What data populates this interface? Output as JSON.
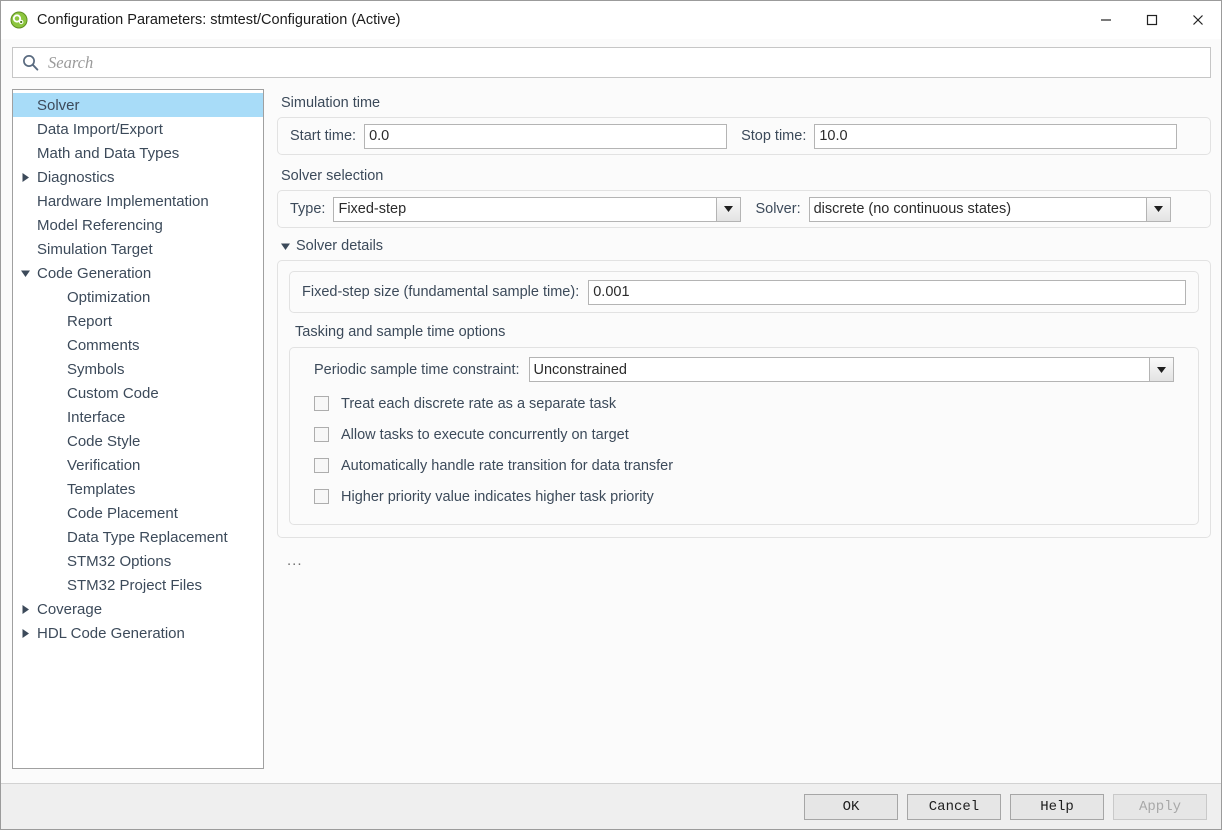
{
  "window": {
    "title": "Configuration Parameters: stmtest/Configuration (Active)",
    "app_icon": "simulink-icon",
    "controls": {
      "minimize": "minimize-icon",
      "maximize": "maximize-icon",
      "close": "close-icon"
    }
  },
  "search": {
    "icon": "search-icon",
    "placeholder": "Search",
    "value": ""
  },
  "sidebar": {
    "items": [
      {
        "label": "Solver",
        "level": 0,
        "arrow": "none",
        "selected": true
      },
      {
        "label": "Data Import/Export",
        "level": 0,
        "arrow": "none",
        "selected": false
      },
      {
        "label": "Math and Data Types",
        "level": 0,
        "arrow": "none",
        "selected": false
      },
      {
        "label": "Diagnostics",
        "level": 0,
        "arrow": "collapsed",
        "selected": false
      },
      {
        "label": "Hardware Implementation",
        "level": 0,
        "arrow": "none",
        "selected": false
      },
      {
        "label": "Model Referencing",
        "level": 0,
        "arrow": "none",
        "selected": false
      },
      {
        "label": "Simulation Target",
        "level": 0,
        "arrow": "none",
        "selected": false
      },
      {
        "label": "Code Generation",
        "level": 0,
        "arrow": "expanded",
        "selected": false
      },
      {
        "label": "Optimization",
        "level": 1,
        "arrow": "none",
        "selected": false
      },
      {
        "label": "Report",
        "level": 1,
        "arrow": "none",
        "selected": false
      },
      {
        "label": "Comments",
        "level": 1,
        "arrow": "none",
        "selected": false
      },
      {
        "label": "Symbols",
        "level": 1,
        "arrow": "none",
        "selected": false
      },
      {
        "label": "Custom Code",
        "level": 1,
        "arrow": "none",
        "selected": false
      },
      {
        "label": "Interface",
        "level": 1,
        "arrow": "none",
        "selected": false
      },
      {
        "label": "Code Style",
        "level": 1,
        "arrow": "none",
        "selected": false
      },
      {
        "label": "Verification",
        "level": 1,
        "arrow": "none",
        "selected": false
      },
      {
        "label": "Templates",
        "level": 1,
        "arrow": "none",
        "selected": false
      },
      {
        "label": "Code Placement",
        "level": 1,
        "arrow": "none",
        "selected": false
      },
      {
        "label": "Data Type Replacement",
        "level": 1,
        "arrow": "none",
        "selected": false
      },
      {
        "label": "STM32 Options",
        "level": 1,
        "arrow": "none",
        "selected": false
      },
      {
        "label": "STM32 Project Files",
        "level": 1,
        "arrow": "none",
        "selected": false
      },
      {
        "label": "Coverage",
        "level": 0,
        "arrow": "collapsed",
        "selected": false
      },
      {
        "label": "HDL Code Generation",
        "level": 0,
        "arrow": "collapsed",
        "selected": false
      }
    ]
  },
  "main": {
    "simulation_time": {
      "heading": "Simulation time",
      "start_label": "Start time:",
      "start_value": "0.0",
      "stop_label": "Stop time:",
      "stop_value": "10.0"
    },
    "solver_selection": {
      "heading": "Solver selection",
      "type_label": "Type:",
      "type_value": "Fixed-step",
      "solver_label": "Solver:",
      "solver_value": "discrete (no continuous states)"
    },
    "solver_details": {
      "disclosure_label": "Solver details",
      "expanded": true,
      "fixed_step_label": "Fixed-step size (fundamental sample time):",
      "fixed_step_value": "0.001",
      "tasking_heading": "Tasking and sample time options",
      "periodic_label": "Periodic sample time constraint:",
      "periodic_value": "Unconstrained",
      "checkboxes": [
        {
          "label": "Treat each discrete rate as a separate task",
          "checked": false
        },
        {
          "label": "Allow tasks to execute concurrently on target",
          "checked": false
        },
        {
          "label": "Automatically handle rate transition for data transfer",
          "checked": false
        },
        {
          "label": "Higher priority value indicates higher task priority",
          "checked": false
        }
      ]
    },
    "overflow_indicator": "..."
  },
  "footer": {
    "ok_label": "OK",
    "cancel_label": "Cancel",
    "help_label": "Help",
    "apply_label": "Apply",
    "apply_enabled": false
  },
  "colors": {
    "selection": "#a8dcf8",
    "label_text": "#3c4a5a",
    "panel_border": "#e2e2e2",
    "footer_bg": "#efefef"
  }
}
